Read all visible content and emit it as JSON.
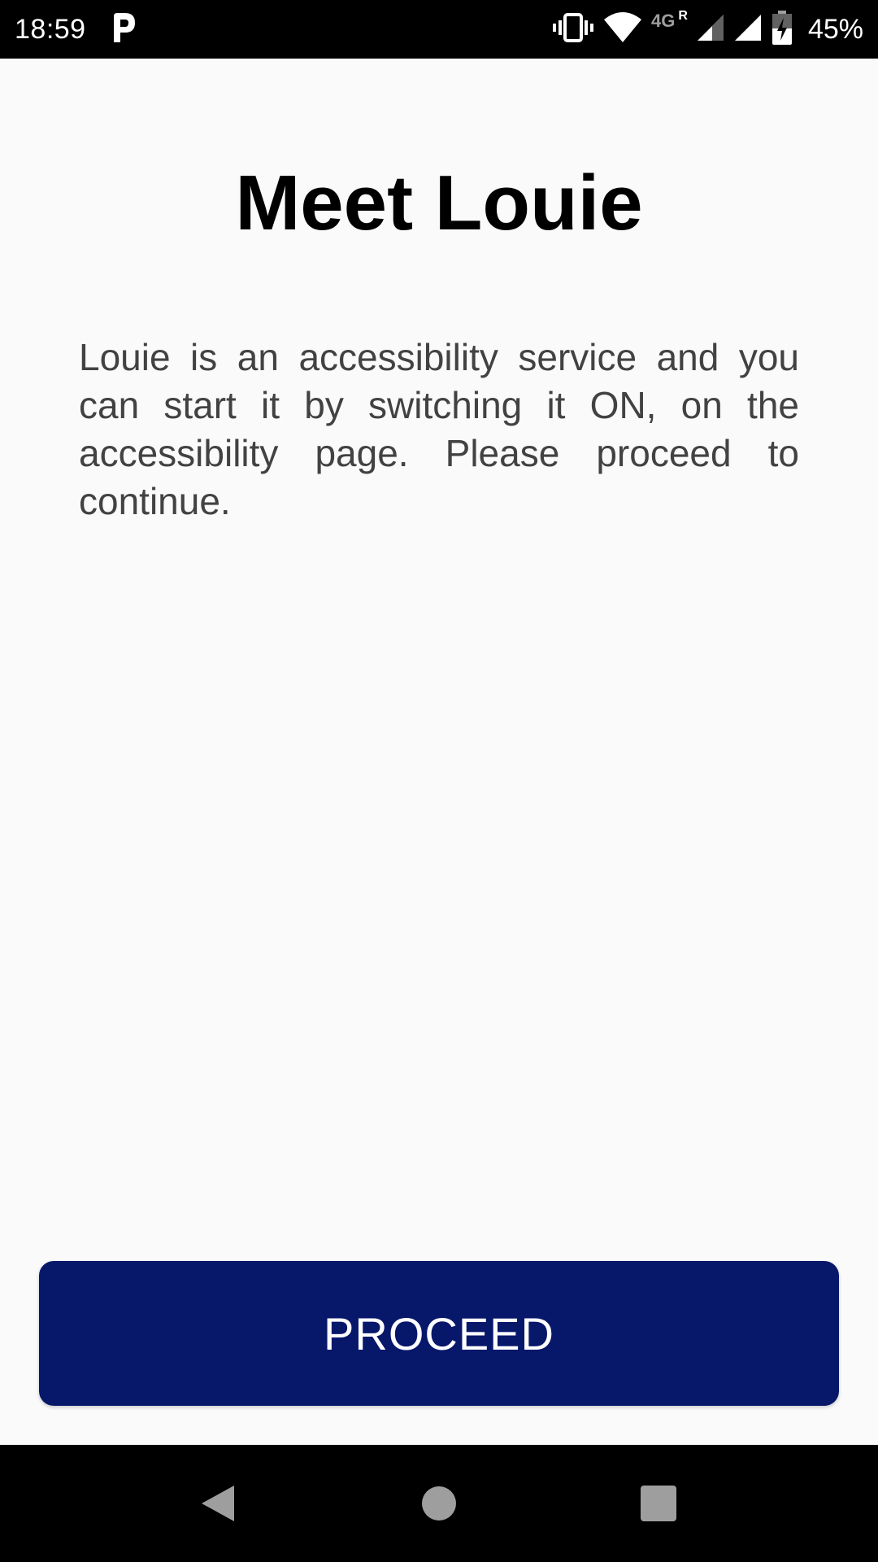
{
  "status_bar": {
    "time": "18:59",
    "network_label": "4G",
    "roaming_label": "R",
    "battery_percent": "45%",
    "icons": [
      "parking-app-icon",
      "vibrate-icon",
      "wifi-icon",
      "signal-icon",
      "signal-icon-2",
      "battery-charging-icon"
    ]
  },
  "screen": {
    "title": "Meet Louie",
    "description": "Louie is an accessibility service and you can start it by switching it ON, on the accessibility page. Please proceed to continue.",
    "proceed_label": "PROCEED"
  },
  "colors": {
    "background": "#fafafa",
    "button": "#07186b",
    "title_text": "#000000",
    "body_text": "#424242"
  },
  "nav_bar": {
    "icons": [
      "back-icon",
      "home-icon",
      "recents-icon"
    ]
  }
}
